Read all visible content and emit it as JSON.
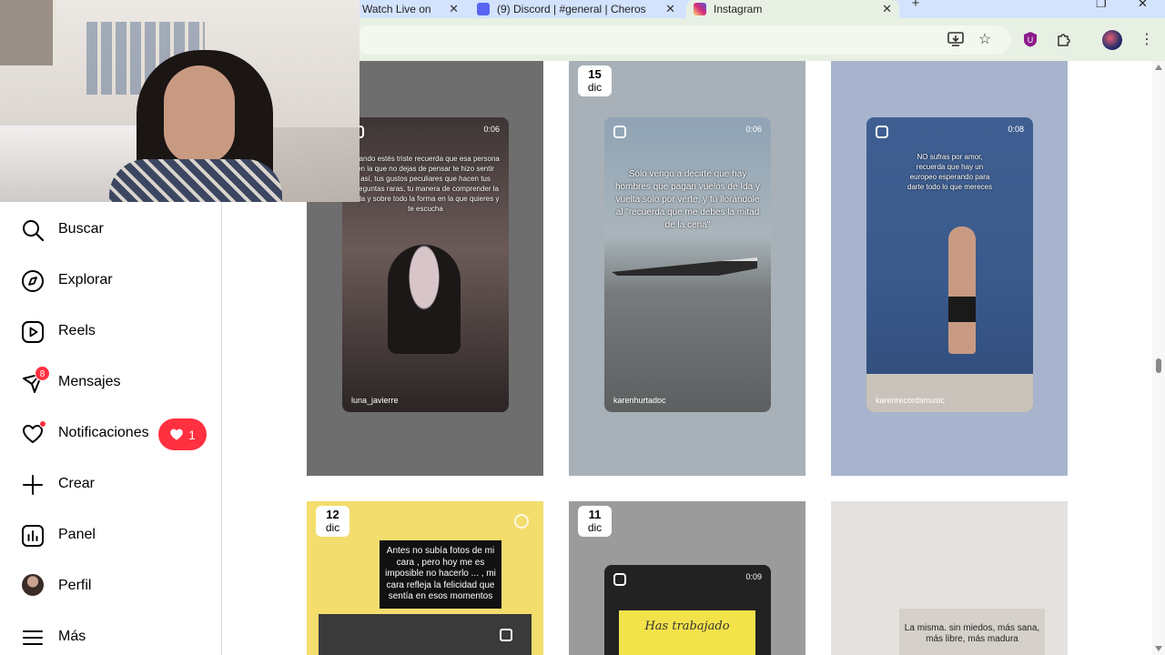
{
  "browser": {
    "tabs": [
      {
        "title": "Watch Live on",
        "active": false
      },
      {
        "title": "(9) Discord | #general | Cheros",
        "active": false
      },
      {
        "title": "Instagram",
        "active": true
      }
    ],
    "new_tab": "+",
    "close_glyph": "✕"
  },
  "sidebar": {
    "items": [
      {
        "label": "Buscar",
        "icon": "search-icon"
      },
      {
        "label": "Explorar",
        "icon": "compass-icon"
      },
      {
        "label": "Reels",
        "icon": "reels-icon"
      },
      {
        "label": "Mensajes",
        "icon": "messenger-icon",
        "badge": "8"
      },
      {
        "label": "Notificaciones",
        "icon": "heart-icon",
        "pill_count": "1"
      },
      {
        "label": "Crear",
        "icon": "plus-icon"
      },
      {
        "label": "Panel",
        "icon": "chart-icon"
      },
      {
        "label": "Perfil",
        "icon": "avatar"
      },
      {
        "label": "Más",
        "icon": "menu-icon"
      }
    ]
  },
  "posts": [
    {
      "day": "",
      "month": "",
      "duration": "0:06",
      "username": "luna_javierre",
      "caption": "cuando estés triste recuerda que esa persona en la que no dejas de pensar te hizo sentir así, tus gustos peculiares que hacen tus preguntas raras, tu manera de comprender la vida y sobre todo la forma en la que quieres y te escucha"
    },
    {
      "day": "15",
      "month": "dic",
      "duration": "0:06",
      "username": "karenhurtadoc",
      "caption": "Sólo vengo a decirte que hay hombres que pagan vuelos de Ida y vuelta solo por verte, y tú llorándole al \"recuerda que me debes la mitad de la cena\""
    },
    {
      "day": "",
      "month": "",
      "duration": "0:08",
      "username": "karenrecordsmusic",
      "caption": "NO sufras por amor, recuerda que hay un europeo esperando para darte todo lo que mereces"
    },
    {
      "day": "12",
      "month": "dic",
      "duration": "",
      "username": "",
      "caption": "Antes no subía fotos de mi cara , pero hoy me es imposible no hacerlo ... , mi cara refleja la felicidad que sentía en esos momentos"
    },
    {
      "day": "11",
      "month": "dic",
      "duration": "0:09",
      "username": "",
      "caption": "Has trabajado"
    },
    {
      "day": "",
      "month": "",
      "duration": "",
      "username": "",
      "caption": "La misma. sin miedos, más sana, más libre, más madura"
    }
  ],
  "colors": {
    "accent_red": "#ff3040",
    "chrome_green": "#e8f0e4",
    "tab_blue": "#d3e3fd"
  }
}
